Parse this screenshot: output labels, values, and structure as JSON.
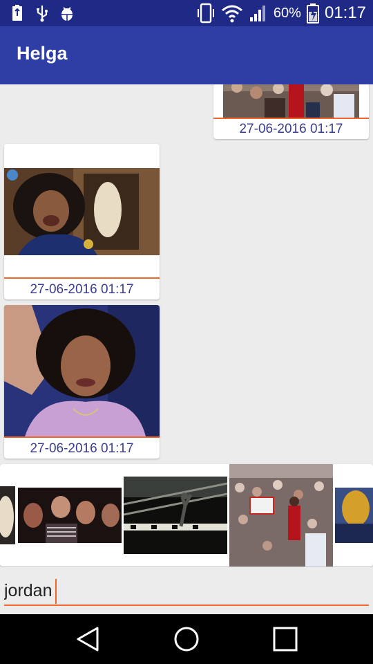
{
  "status_bar": {
    "battery_percent": "60%",
    "time": "01:17",
    "icons": [
      "battery-saver-icon",
      "usb-icon",
      "android-debug-icon",
      "vibrate-icon",
      "wifi-icon",
      "signal-icon",
      "battery-charging-icon"
    ]
  },
  "app_bar": {
    "title": "Helga"
  },
  "messages": [
    {
      "timestamp": "27-06-2016 01:17",
      "gif": "basketball-dunk-crowd-gif",
      "side": "right"
    },
    {
      "timestamp": "27-06-2016 01:17",
      "gif": "woman-laughing-gif",
      "side": "left"
    },
    {
      "timestamp": "27-06-2016 01:17",
      "gif": "woman-waving-gif",
      "side": "left"
    }
  ],
  "suggestions": [
    "partial-face-gif",
    "friends-laughing-gif",
    "player-silhouette-dunk-gif",
    "jordan-dunk-crowd-gif",
    "player-blurred-gif"
  ],
  "input": {
    "value": "jordan"
  },
  "nav_bar": {
    "icons": [
      "back-icon",
      "home-icon",
      "recents-icon"
    ]
  }
}
